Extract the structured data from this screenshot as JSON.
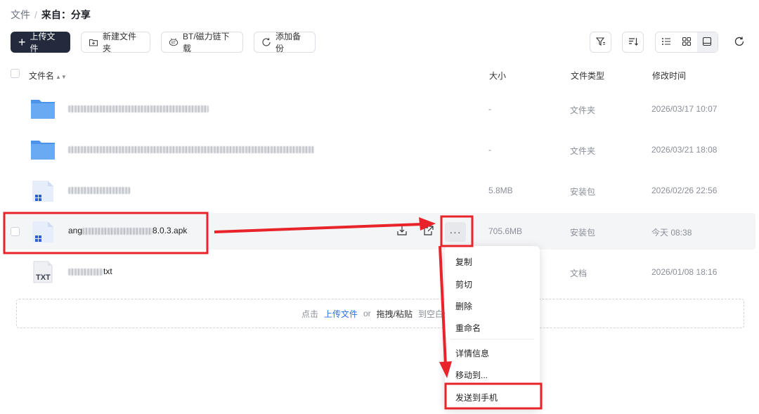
{
  "breadcrumb": {
    "root": "文件",
    "separator": "/",
    "current": "来自：分享"
  },
  "toolbar": {
    "upload_label": "上传文件",
    "new_folder_label": "新建文件夹",
    "bt_label": "BT/磁力链下载",
    "backup_label": "添加备份"
  },
  "columns": {
    "name": "文件名",
    "size": "大小",
    "type": "文件类型",
    "modified": "修改时间"
  },
  "files": [
    {
      "icon": "folder-icon",
      "name": "",
      "size": "-",
      "type": "文件夹",
      "modified": "2026/03/17 10:07"
    },
    {
      "icon": "folder-icon",
      "name": "",
      "size": "-",
      "type": "文件夹",
      "modified": "2026/03/21 18:08"
    },
    {
      "icon": "package-icon",
      "name": "",
      "size": "5.8MB",
      "type": "安装包",
      "modified": "2026/02/26 22:56"
    },
    {
      "icon": "package-icon",
      "name_prefix": "ang",
      "name_suffix": "8.0.3.apk",
      "size": "705.6MB",
      "type": "安装包",
      "modified": "今天 08:38"
    },
    {
      "icon": "txt-icon",
      "name_suffix": "txt",
      "size": "",
      "type": "文档",
      "modified": "2026/01/08 18:16",
      "icon_text": "TXT"
    }
  ],
  "dropzone": {
    "prefix": "点击",
    "upload_link": "上传文件",
    "or": "or",
    "drag": "拖拽/粘贴",
    "suffix": "到空白处..."
  },
  "context_menu": {
    "items": [
      "复制",
      "剪切",
      "删除",
      "重命名",
      "详情信息",
      "移动到...",
      "发送到手机"
    ]
  },
  "colors": {
    "primary_dark": "#232a3d",
    "link": "#2f6fe4",
    "annotation": "#e8232a",
    "folder": "#5aa2f0"
  }
}
